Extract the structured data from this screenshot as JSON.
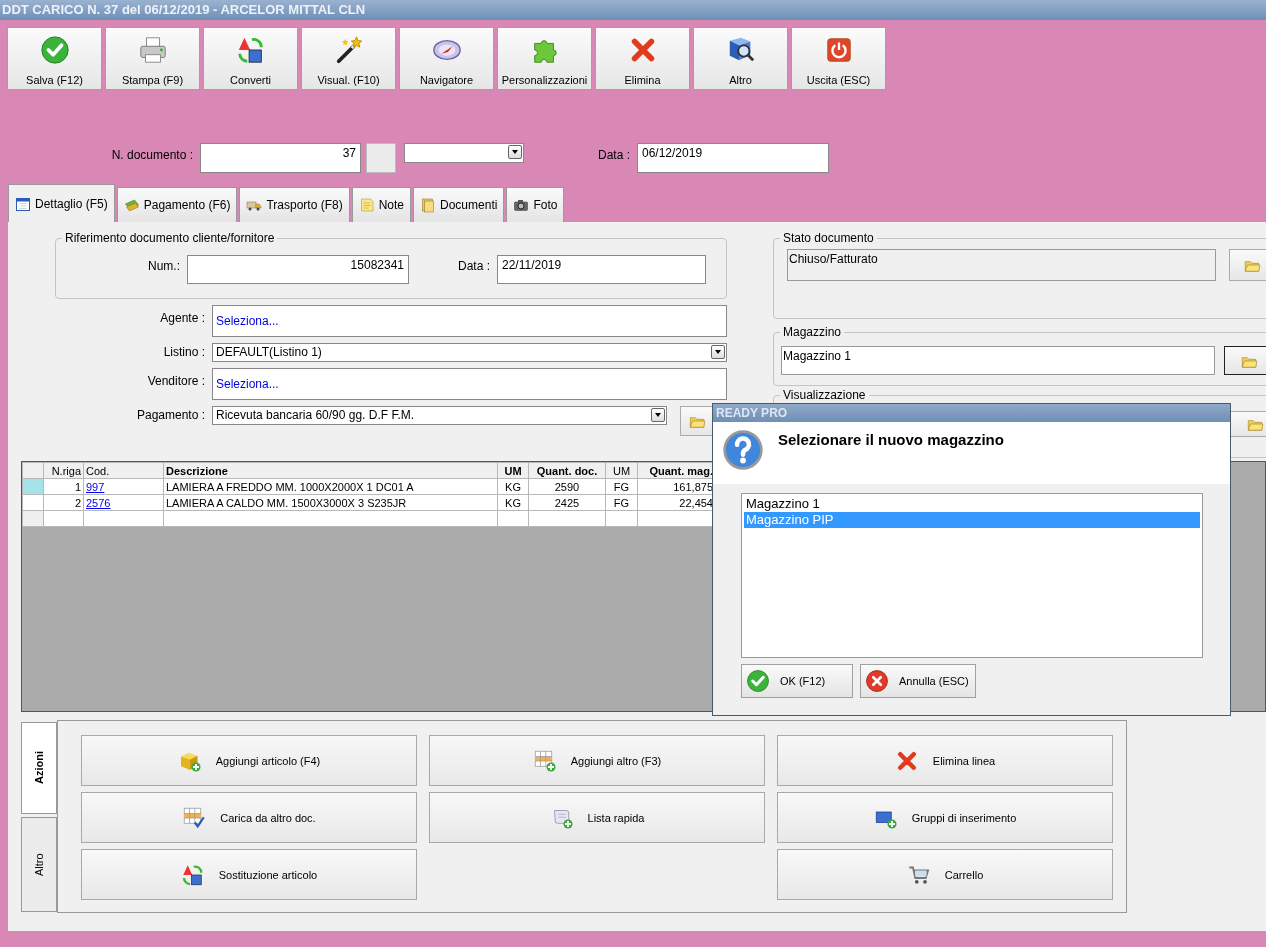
{
  "window": {
    "title": "DDT CARICO N. 37 del 06/12/2019 - ARCELOR MITTAL CLN"
  },
  "toolbar": [
    {
      "label": "Salva (F12)",
      "kind": "save"
    },
    {
      "label": "Stampa (F9)",
      "kind": "print"
    },
    {
      "label": "Converti",
      "kind": "convert"
    },
    {
      "label": "Visual. (F10)",
      "kind": "visual"
    },
    {
      "label": "Navigatore",
      "kind": "navigator"
    },
    {
      "label": "Personalizzazioni",
      "kind": "customize"
    },
    {
      "label": "Elimina",
      "kind": "delete"
    },
    {
      "label": "Altro",
      "kind": "more"
    },
    {
      "label": "Uscita (ESC)",
      "kind": "exit"
    }
  ],
  "header": {
    "number_label": "N. documento :",
    "number": "37",
    "date_label": "Data :",
    "date": "06/12/2019"
  },
  "tabs": [
    {
      "label": "Dettaglio (F5)",
      "kind": "detail",
      "selected": true
    },
    {
      "label": "Pagamento (F6)",
      "kind": "payment",
      "selected": false
    },
    {
      "label": "Trasporto (F8)",
      "kind": "transport",
      "selected": false
    },
    {
      "label": "Note",
      "kind": "notes",
      "selected": false
    },
    {
      "label": "Documenti",
      "kind": "documents",
      "selected": false
    },
    {
      "label": "Foto",
      "kind": "photo",
      "selected": false
    }
  ],
  "reference": {
    "title": "Riferimento documento cliente/fornitore",
    "number_label": "Num.:",
    "number": "15082341",
    "date_label": "Data :",
    "date": "22/11/2019"
  },
  "fields": [
    {
      "label": "Agente :",
      "value": "Seleziona...",
      "kind": "link"
    },
    {
      "label": "Listino :",
      "value": "DEFAULT(Listino 1)",
      "kind": "dropdown"
    },
    {
      "label": "Venditore :",
      "value": "Seleziona...",
      "kind": "link"
    },
    {
      "label": "Pagamento :",
      "value": "Ricevuta bancaria 60/90 gg. D.F F.M.",
      "kind": "dropdown-folder"
    }
  ],
  "side": {
    "status": {
      "title": "Stato documento",
      "value": "Chiuso/Fatturato",
      "disabled": true,
      "button_focused": false
    },
    "warehouse": {
      "title": "Magazzino",
      "value": "Magazzino 1",
      "disabled": false,
      "button_focused": true
    },
    "view": {
      "title": "Visualizzazione"
    }
  },
  "table": {
    "columns": [
      {
        "label": "N.riga",
        "kind": "index",
        "bold": false
      },
      {
        "label": "Cod.",
        "kind": "link",
        "bold": false
      },
      {
        "label": "Descrizione",
        "kind": "text",
        "bold": true
      },
      {
        "label": "UM",
        "kind": "center",
        "bold": true
      },
      {
        "label": "Quant. doc.",
        "kind": "center",
        "bold": true
      },
      {
        "label": "UM",
        "kind": "center",
        "bold": false
      },
      {
        "label": "Quant. mag.",
        "kind": "amount",
        "bold": true
      }
    ],
    "rows": [
      {
        "selected": true,
        "cells": [
          "1",
          "997",
          "LAMIERA A FREDDO MM. 1000X2000X 1 DC01 A",
          "KG",
          "2590",
          "FG",
          "161,875"
        ]
      },
      {
        "selected": false,
        "cells": [
          "2",
          "2576",
          "LAMIERA A CALDO MM. 1500X3000X 3 S235JR",
          "KG",
          "2425",
          "FG",
          "22,454"
        ]
      }
    ]
  },
  "dialog": {
    "title": "READY PRO",
    "message": "Selezionare il nuovo magazzino",
    "options": [
      {
        "label": "Magazzino 1",
        "selected": false
      },
      {
        "label": "Magazzino PIP",
        "selected": true
      }
    ],
    "buttons": [
      {
        "label": "OK (F12)",
        "kind": "ok"
      },
      {
        "label": "Annulla (ESC)",
        "kind": "cancel"
      }
    ]
  },
  "actions": {
    "tabs": [
      {
        "label": "Azioni",
        "selected": true
      },
      {
        "label": "Altro",
        "selected": false
      }
    ],
    "columns": [
      [
        {
          "label": "Aggiungi articolo (F4)",
          "kind": "add-item"
        },
        {
          "label": "Carica da altro doc.",
          "kind": "load"
        },
        {
          "label": "Sostituzione articolo",
          "kind": "replace"
        }
      ],
      [
        {
          "label": "Aggiungi altro (F3)",
          "kind": "add-other"
        },
        {
          "label": "Lista rapida",
          "kind": "quick-list"
        }
      ],
      [
        {
          "label": "Elimina linea",
          "kind": "delete-line"
        },
        {
          "label": "Gruppi di inserimento",
          "kind": "groups"
        },
        {
          "label": "Carrello",
          "kind": "cart"
        }
      ]
    ]
  }
}
